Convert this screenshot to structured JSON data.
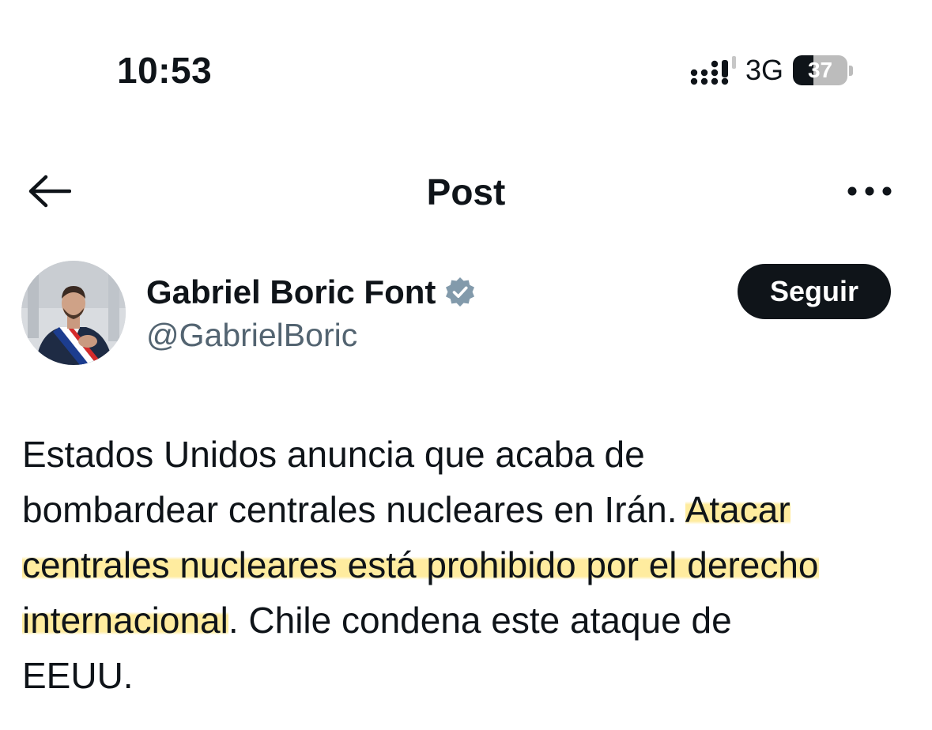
{
  "status_bar": {
    "time": "10:53",
    "network": "3G",
    "battery_level": "37",
    "battery_fraction": 0.37,
    "signal_icon": "cellular-signal-icon"
  },
  "header": {
    "title": "Post",
    "back_icon": "arrow-left-icon",
    "more_icon": "more-horizontal-icon"
  },
  "author": {
    "name": "Gabriel Boric Font",
    "handle": "@GabrielBoric",
    "verified_icon": "verified-badge-icon",
    "follow_label": "Seguir"
  },
  "post": {
    "lines": [
      [
        "Estados Unidos anuncia que acaba de"
      ],
      [
        "bombardear centrales nucleares en Irán. ",
        "Atacar"
      ],
      [
        "centrales nucleares está prohibido por el derecho"
      ],
      [
        "internacional",
        ". Chile condena este ataque de"
      ],
      [
        "EEUU."
      ]
    ]
  },
  "colors": {
    "text": "#0f1419",
    "secondary_text": "#536471",
    "verified_badge": "#829aab",
    "follow_button_bg": "#0f1419",
    "highlight": "#ffdc50"
  }
}
